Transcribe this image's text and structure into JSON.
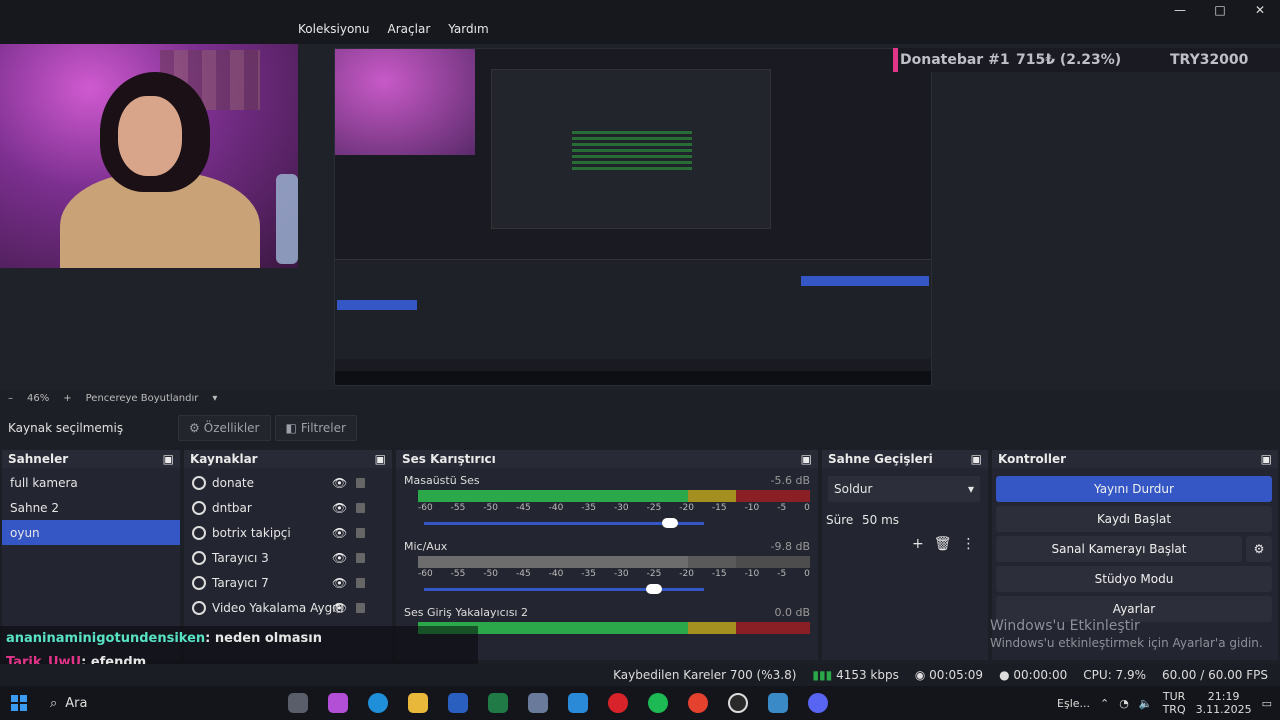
{
  "menu": {
    "items": [
      "Koleksiyonu",
      "Araçlar",
      "Yardım"
    ]
  },
  "window_controls": {
    "minimize": "—",
    "maximize": "□",
    "close": "✕"
  },
  "donation_bar": {
    "label": "Donatebar #1",
    "amount": "715₺ (2.23%)",
    "goal": "TRY32000"
  },
  "preview_toolbar": {
    "zoom": "46%",
    "minus": "–",
    "plus": "+",
    "fit_label": "Pencereye Boyutlandır"
  },
  "props_bar": {
    "label": "Kaynak seçilmemiş",
    "properties": "Özellikler",
    "filters": "Filtreler"
  },
  "scenes": {
    "title": "Sahneler",
    "items": [
      "full kamera",
      "Sahne 2",
      "oyun"
    ],
    "active_index": 2
  },
  "sources": {
    "title": "Kaynaklar",
    "items": [
      "donate",
      "dntbar",
      "botrix takipçi",
      "Tarayıcı 3",
      "Tarayıcı 7",
      "Video Yakalama Aygıtı"
    ]
  },
  "mixer": {
    "title": "Ses Karıştırıcı",
    "channels": [
      {
        "name": "Masaüstü Ses",
        "db": "-5.6 dB",
        "volume_level": 0.88
      },
      {
        "name": "Mic/Aux",
        "db": "-9.8 dB",
        "volume_level": 0.82
      },
      {
        "name": "Ses Giriş Yakalayıcısı 2",
        "db": "0.0 dB"
      }
    ],
    "ticks": [
      "-60",
      "-55",
      "-50",
      "-45",
      "-40",
      "-35",
      "-30",
      "-25",
      "-20",
      "-15",
      "-10",
      "-5",
      "0"
    ]
  },
  "transitions": {
    "title": "Sahne Geçişleri",
    "selected": "Soldur",
    "duration_label": "Süre",
    "duration_value": "50 ms"
  },
  "controls": {
    "title": "Kontroller",
    "buttons": [
      "Yayını Durdur",
      "Kaydı Başlat",
      "Sanal Kamerayı Başlat",
      "Stüdyo Modu",
      "Ayarlar"
    ]
  },
  "activation": {
    "title": "Windows'u Etkinleştir",
    "subtitle": "Windows'u etkinleştirmek için Ayarlar'a gidin."
  },
  "chat": [
    {
      "user": "ananinaminigotundensiken",
      "message": ": neden olmasın"
    },
    {
      "user": "Tarik_UwU",
      "message": ": efendm"
    }
  ],
  "status": {
    "dropped": "Kaybedilen Kareler 700 (%3.8)",
    "bitrate": "4153 kbps",
    "live_time": "00:05:09",
    "rec_time": "00:00:00",
    "cpu": "CPU: 7.9%",
    "fps": "60.00 / 60.00 FPS"
  },
  "taskbar": {
    "search": "Ara",
    "tray_label": "Eşle...",
    "lang_top": "TUR",
    "lang_bottom": "TRQ",
    "time": "21:19",
    "date": "3.11.2025"
  },
  "colors": {
    "accent": "#3557c6",
    "donate_accent": "#e2358a",
    "meter_green": "#2aa84a"
  }
}
